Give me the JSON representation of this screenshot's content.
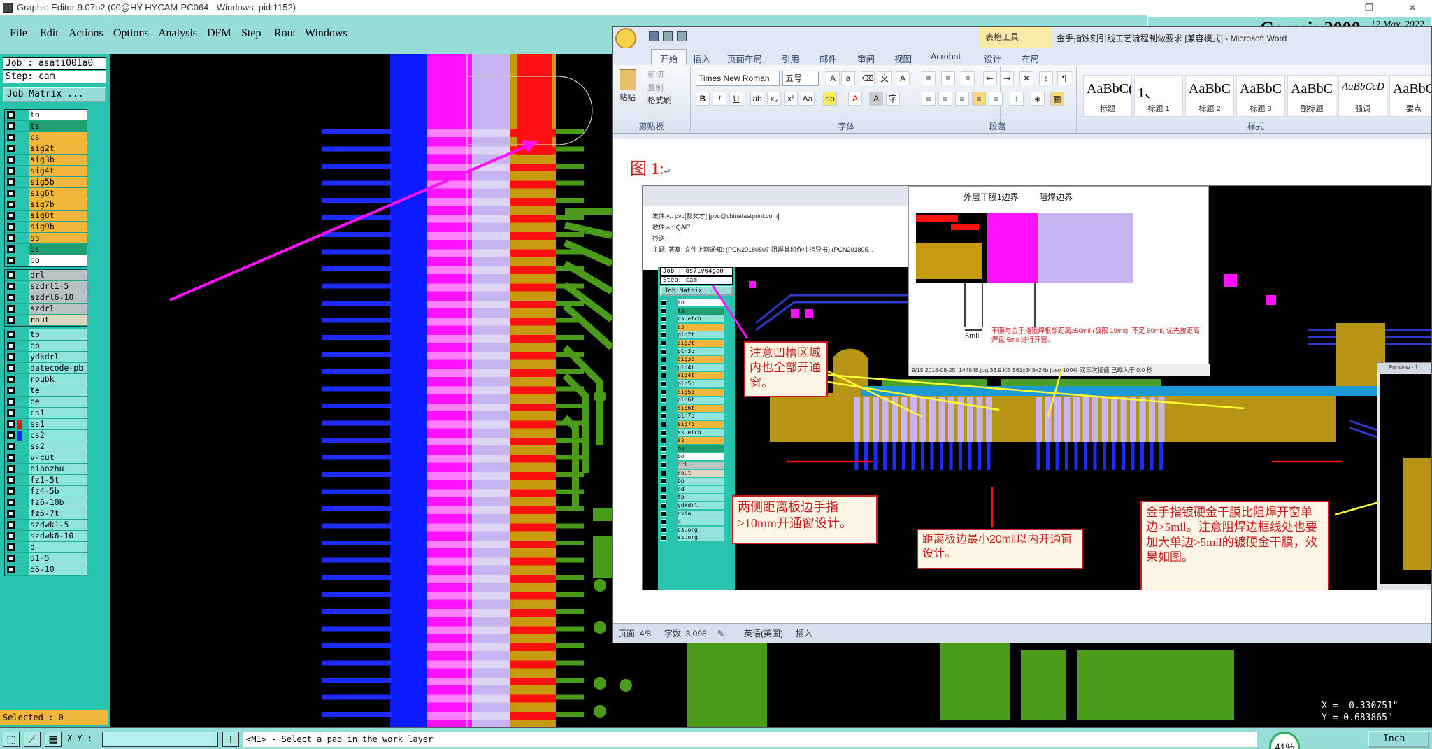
{
  "app": {
    "title": "Graphic Editor 9.07b2 (00@HY-HYCAM-PC064 - Windows, pid:1152)",
    "menu": [
      "File",
      "Edit",
      "Actions",
      "Options",
      "Analysis",
      "DFM",
      "Step",
      "Rout",
      "Windows"
    ],
    "branding": {
      "product": "Genesis 2000",
      "date": "12 May, 2022"
    }
  },
  "panel": {
    "job": "Job : asati001a0",
    "step": "Step: cam",
    "job_matrix": "Job Matrix ...",
    "layers_group1": [
      {
        "name": "to",
        "color": "#ffffff",
        "selected": true
      },
      {
        "name": "ts",
        "color": "#1f9f6f",
        "selected": false
      },
      {
        "name": "cs",
        "color": "#f2b63c",
        "selected": false
      },
      {
        "name": "sig2t",
        "color": "#f2b63c",
        "selected": false
      },
      {
        "name": "sig3b",
        "color": "#f2b63c",
        "selected": false
      },
      {
        "name": "sig4t",
        "color": "#f2b63c",
        "selected": false
      },
      {
        "name": "sig5b",
        "color": "#f2b63c",
        "selected": false
      },
      {
        "name": "sig6t",
        "color": "#f2b63c",
        "selected": false
      },
      {
        "name": "sig7b",
        "color": "#f2b63c",
        "selected": false
      },
      {
        "name": "sig8t",
        "color": "#f2b63c",
        "selected": false
      },
      {
        "name": "sig9b",
        "color": "#f2b63c",
        "selected": false
      },
      {
        "name": "ss",
        "color": "#f2b63c",
        "selected": false
      },
      {
        "name": "bs",
        "color": "#1f9f6f",
        "selected": false
      },
      {
        "name": "bo",
        "color": "#ffffff",
        "selected": false
      }
    ],
    "layers_group2": [
      {
        "name": "drl",
        "color": "#b9c2c2"
      },
      {
        "name": "szdrl1-5",
        "color": "#b9c2c2"
      },
      {
        "name": "szdrl6-10",
        "color": "#b9c2c2"
      },
      {
        "name": "szdrl",
        "color": "#b9c2c2"
      },
      {
        "name": "rout",
        "color": "#ddd6c0"
      }
    ],
    "layers_group3": [
      {
        "name": "tp",
        "color": "#8fe4dc"
      },
      {
        "name": "bp",
        "color": "#8fe4dc"
      },
      {
        "name": "ydkdrl",
        "color": "#8fe4dc"
      },
      {
        "name": "datecode-pb",
        "color": "#8fe4dc"
      },
      {
        "name": "roubk",
        "color": "#8fe4dc"
      },
      {
        "name": "te",
        "color": "#8fe4dc"
      },
      {
        "name": "be",
        "color": "#8fe4dc"
      },
      {
        "name": "cs1",
        "color": "#8fe4dc"
      },
      {
        "name": "ss1",
        "color": "#8fe4dc"
      },
      {
        "name": "cs2",
        "color": "#8fe4dc"
      },
      {
        "name": "ss2",
        "color": "#8fe4dc"
      },
      {
        "name": "v-cut",
        "color": "#8fe4dc"
      },
      {
        "name": "biaozhu",
        "color": "#8fe4dc"
      },
      {
        "name": "fz1-5t",
        "color": "#8fe4dc"
      },
      {
        "name": "fz4-5b",
        "color": "#8fe4dc"
      },
      {
        "name": "fz6-10b",
        "color": "#8fe4dc"
      },
      {
        "name": "fz6-7t",
        "color": "#8fe4dc"
      },
      {
        "name": "szdwk1-5",
        "color": "#8fe4dc"
      },
      {
        "name": "szdwk6-10",
        "color": "#8fe4dc"
      },
      {
        "name": "d",
        "color": "#8fe4dc"
      },
      {
        "name": "d1-5",
        "color": "#8fe4dc"
      },
      {
        "name": "d6-10",
        "color": "#8fe4dc"
      }
    ],
    "selected": "Selected : 0"
  },
  "bottom": {
    "xy_label": "X Y :",
    "status_message": "<M1> - Select a pad in the work layer",
    "units": "Inch",
    "coord_x": "X = -0.330751\"",
    "coord_y": "Y = 0.683865\"",
    "progress": "41%"
  },
  "word": {
    "title": "金手指蚀刻引线工艺流程制做要求 [兼容模式] - Microsoft Word",
    "table_tools": "表格工具",
    "tabs": [
      "开始",
      "插入",
      "页面布局",
      "引用",
      "邮件",
      "审阅",
      "视图",
      "Acrobat",
      "设计",
      "布局"
    ],
    "clipboard": {
      "paste": "粘贴",
      "cut": "剪切",
      "copy": "复制",
      "format_painter": "格式刷",
      "label": "剪贴板"
    },
    "font": {
      "name": "Times New Roman",
      "size": "五号",
      "label": "字体"
    },
    "paragraph_label": "段落",
    "styles_label": "样式",
    "styles": [
      {
        "preview": "AaBbC(",
        "name": "标题"
      },
      {
        "preview": "1、",
        "name": "标题 1"
      },
      {
        "preview": "AaBbC",
        "name": "标题 2"
      },
      {
        "preview": "AaBbC",
        "name": "标题 3"
      },
      {
        "preview": "AaBbC",
        "name": "副标题"
      },
      {
        "preview": "AaBbCcD",
        "name": "强调"
      },
      {
        "preview": "AaBbC",
        "name": "要点"
      }
    ],
    "doc_heading": "图 1:",
    "status": {
      "page": "页面: 4/8",
      "words": "字数: 3,098",
      "lang": "英语(美国)",
      "mode": "插入"
    }
  },
  "embedded": {
    "mail": {
      "from": "发件人: pvc[彭文才] [pvc@chinafastprint.com]",
      "to": "收件人: 'QAE'",
      "cc": "抄送:",
      "subject": "主题: 答复: 文件上网通知: (PCN20180507-阻焊丝印作业指导书) (PCN201805..."
    },
    "mini_job": "Job : 8s71v04ga0",
    "mini_step": "Step: cam",
    "mini_matrix": "Job Matrix ...",
    "mini_layers": [
      "to",
      "ts",
      "cs.etch",
      "cs",
      "pln2t",
      "sig2t",
      "pln3b",
      "sig3b",
      "pln4t",
      "sig4t",
      "pln5b",
      "sig5b",
      "pln6t",
      "sig6t",
      "pln7b",
      "sig7b",
      "ss.etch",
      "ss",
      "bs",
      "bo",
      "drl",
      "rout",
      "bp",
      "dd",
      "tp",
      "ydkdrl",
      "cvia",
      "d",
      "cs.org",
      "ss.org"
    ],
    "popup_labels": {
      "outer": "外层干膜1边界",
      "solder": "阻焊边界",
      "five_mil": "5mil",
      "note": "干膜与金手指阻焊根部距离≥50mil (极限 19mil), 不足 50mil, 优先按距离焊盘 5mil 进行开窗。"
    },
    "popup_footer": "9/15  2018-08-25_144848.jpg  36.9 KB  561x349x24b jpeg  100%  双三次插值  已载入于 0.0 秒",
    "callouts": {
      "c1": "注意凹槽区域内也全部开通窗。",
      "c2": "两侧距离板边手指≥10mm开通窗设计。",
      "c3": "距离板边最小20mil以内开通窗设计。",
      "c4": "金手指镀硬金干膜比阻焊开窗单边>5mil。注意阻焊边框线处也要加大单边>5mil的镀硬金干膜，效果如图。"
    },
    "popview": "Popview - 1"
  }
}
